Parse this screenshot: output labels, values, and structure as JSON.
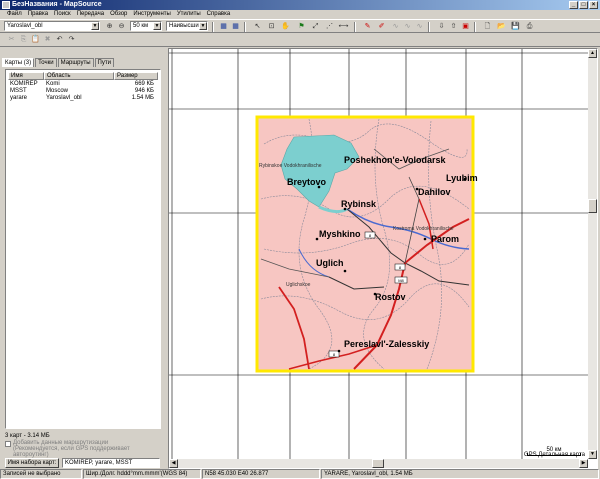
{
  "window": {
    "title": "БезНазвания - MapSource"
  },
  "menu": [
    "Файл",
    "Правка",
    "Поиск",
    "Передача",
    "Обзор",
    "Инструменты",
    "Утилиты",
    "Справка"
  ],
  "toolbar": {
    "map_select": "Yaroslavl_obl",
    "zoom_level": "50 км",
    "detail_level": "Наивысший"
  },
  "left_panel": {
    "tabs": [
      "Карты (3)",
      "Точки",
      "Маршруты",
      "Пути"
    ],
    "columns": [
      "Имя",
      "Область",
      "Размер"
    ],
    "rows": [
      {
        "name": "KOMIREP",
        "region": "Komi",
        "size": "669 КБ"
      },
      {
        "name": "MSST",
        "region": "Moscow",
        "size": "946 КБ"
      },
      {
        "name": "yarare",
        "region": "Yaroslavl_obl",
        "size": "1.54 МБ"
      }
    ],
    "summary": "3 карт - 3.14 МБ",
    "checkbox_label": "Добавить данные маршрутизации",
    "checkbox_note": "(Рекомендуется, если GPS поддерживает автороутинг)",
    "device_button": "Имя набора карт:",
    "device_value": "KOMIREP, yarare, MSST"
  },
  "map": {
    "cities": [
      "Poshekhon'e-Volodarsk",
      "Breytovo",
      "Rybinsk",
      "Dahilov",
      "Lyubim",
      "Myshkino",
      "Parom",
      "Uglich",
      "Rostov",
      "Pereslavl'-Zalesskiy"
    ],
    "small_labels": [
      "Rybinskoe Vodokhranilische",
      "Kostroma Vodokhranilische",
      "Uglichskoe"
    ],
    "road_numbers": [
      "8",
      "8",
      "M8",
      "8"
    ],
    "scale_label": "50 км",
    "map_type": "GPS Детальная карта"
  },
  "status": {
    "selection": "Записей не выбрано",
    "coord_format": "Шир./Долг. hddd°mm.mmm'(WGS 84)",
    "coordinates": "N58 45.030 E40 26.877",
    "map_info": "YARARE, Yaroslavl_obl, 1.54 МБ"
  },
  "colors": {
    "title_bar": "#0a246a",
    "map_fill": "#f7c6c2",
    "map_border": "#ffe800",
    "water": "#7ccfcf"
  }
}
